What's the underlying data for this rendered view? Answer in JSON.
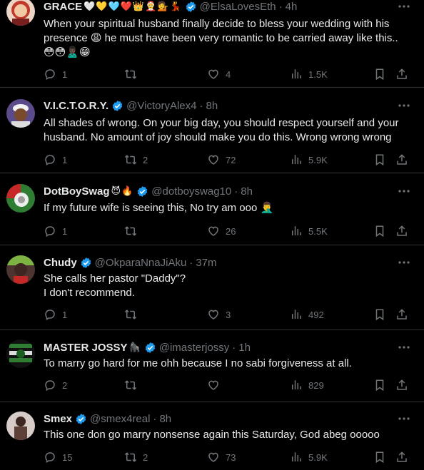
{
  "tweets": [
    {
      "name": "GRACE",
      "name_emojis": "🤍💛🩵❤️👑🤶💁💃",
      "handle": "@ElsaLovesEth",
      "time": "4h",
      "text": "When your spiritual husband finally decide to bless your wedding with his presence 😩 he must have been very romantic to be carried away like this.. 😳😳🙎🏿‍♂️😁",
      "replies": "1",
      "retweets": "",
      "likes": "4",
      "views": "1.5K",
      "avatar_color": "#c0392b"
    },
    {
      "name": "V.I.C.T.O.R.Y.",
      "name_emojis": "",
      "handle": "@VictoryAlex4",
      "time": "8h",
      "text": "All shades of wrong. On your big day, you should respect yourself and your husband. No amount of joy should make you do this. Wrong wrong wrong",
      "replies": "1",
      "retweets": "2",
      "likes": "72",
      "views": "5.9K",
      "avatar_color": "#5b4b8a"
    },
    {
      "name": "DotBoySwag",
      "name_emojis": "😈🔥",
      "handle": "@dotboyswag10",
      "time": "8h",
      "text": "If my future wife is seeing this, No try am ooo 🤦‍♂️",
      "replies": "1",
      "retweets": "",
      "likes": "26",
      "views": "5.5K",
      "avatar_color": "#2e7d32"
    },
    {
      "name": "Chudy",
      "name_emojis": "",
      "handle": "@OkparaNnaJiAku",
      "time": "37m",
      "text": "She calls her pastor \"Daddy\"?\nI don't recommend.",
      "replies": "1",
      "retweets": "",
      "likes": "3",
      "views": "492",
      "avatar_color": "#7cb342"
    },
    {
      "name": "MASTER JOSSY",
      "name_emojis": "🦍",
      "handle": "@imasterjossy",
      "time": "1h",
      "text": "To marry go hard for me ohh because I no sabi forgiveness at all.",
      "replies": "2",
      "retweets": "",
      "likes": "",
      "views": "829",
      "avatar_color": "#1b5e20"
    },
    {
      "name": "Smex",
      "name_emojis": "",
      "handle": "@smex4real",
      "time": "8h",
      "text": "This one don go marry nonsense again this Saturday, God abeg ooooo",
      "replies": "15",
      "retweets": "2",
      "likes": "73",
      "views": "5.9K",
      "avatar_color": "#8d6e63"
    }
  ],
  "colors": {
    "background": "#000000",
    "text": "#e7e9ea",
    "muted": "#71767b",
    "divider": "#2f3336",
    "verified": "#1d9bf0"
  },
  "icons": [
    "reply-icon",
    "retweet-icon",
    "like-icon",
    "views-icon",
    "bookmark-icon",
    "share-icon",
    "more-icon",
    "verified-icon"
  ]
}
